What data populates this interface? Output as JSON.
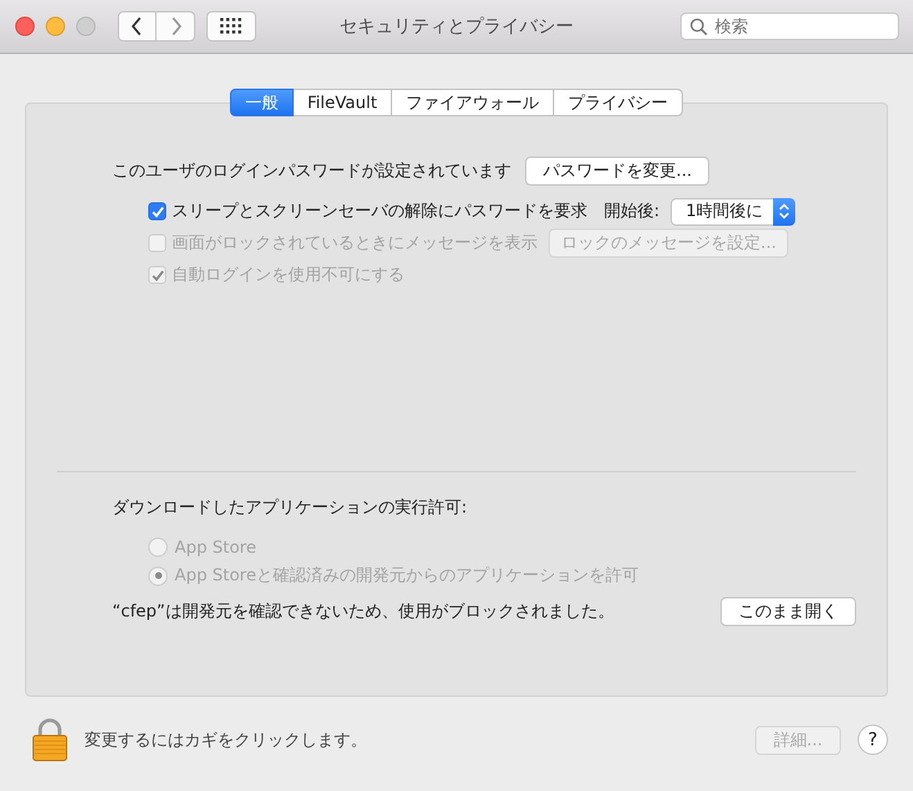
{
  "window": {
    "title": "セキュリティとプライバシー"
  },
  "search": {
    "placeholder": "検索"
  },
  "tabs": [
    {
      "label": "一般",
      "selected": true
    },
    {
      "label": "FileVault",
      "selected": false
    },
    {
      "label": "ファイアウォール",
      "selected": false
    },
    {
      "label": "プライバシー",
      "selected": false
    }
  ],
  "password": {
    "label": "このユーザのログインパスワードが設定されています",
    "button": "パスワードを変更..."
  },
  "options": [
    {
      "kind": "select",
      "label": "スリープとスクリーンセーバの解除にパスワードを要求",
      "checked": true,
      "disabled": false,
      "select_label": "開始後:",
      "select_value": "1時間後に"
    },
    {
      "kind": "button",
      "label": "画面がロックされているときにメッセージを表示",
      "checked": false,
      "disabled": true,
      "button": "ロックのメッセージを設定..."
    },
    {
      "kind": "plain",
      "label": "自動ログインを使用不可にする",
      "checked": true,
      "disabled": true
    }
  ],
  "downloads": {
    "heading": "ダウンロードしたアプリケーションの実行許可:",
    "radios": [
      {
        "label": "App Store",
        "selected": false,
        "disabled": true
      },
      {
        "label": "App Storeと確認済みの開発元からのアプリケーションを許可",
        "selected": true,
        "disabled": true
      }
    ],
    "blocked_message": "“cfep”は開発元を確認できないため、使用がブロックされました。",
    "open_button": "このまま開く"
  },
  "footer": {
    "lock_text": "変更するにはカギをクリックします。",
    "details_button": {
      "label": "詳細...",
      "disabled": true
    },
    "help": "?"
  }
}
